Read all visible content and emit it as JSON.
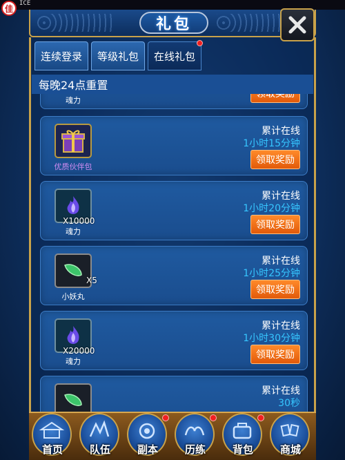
{
  "status": {
    "logo_char": "佳",
    "text": "ICE"
  },
  "header": {
    "title": "礼包"
  },
  "tabs": [
    {
      "label": "连续登录",
      "active": false,
      "has_badge": false
    },
    {
      "label": "等级礼包",
      "active": false,
      "has_badge": false
    },
    {
      "label": "在线礼包",
      "active": true,
      "has_badge": true
    }
  ],
  "notice": "每晚24点重置",
  "rows": [
    {
      "item_name": "魂力",
      "item_icon": "soul-flame-icon",
      "qty": "",
      "label": "累计在线",
      "time": "",
      "button": "领取奖励"
    },
    {
      "item_name": "优质伙伴包",
      "item_icon": "gift-box-icon",
      "qty": "",
      "label": "累计在线",
      "time": "1小时15分钟",
      "button": "领取奖励"
    },
    {
      "item_name": "魂力",
      "item_icon": "soul-flame-icon",
      "qty": "X10000",
      "label": "累计在线",
      "time": "1小时20分钟",
      "button": "领取奖励"
    },
    {
      "item_name": "小妖丸",
      "item_icon": "green-pill-icon",
      "qty": "X5",
      "label": "累计在线",
      "time": "1小时25分钟",
      "button": "领取奖励"
    },
    {
      "item_name": "魂力",
      "item_icon": "soul-flame-icon",
      "qty": "X20000",
      "label": "累计在线",
      "time": "1小时30分钟",
      "button": "领取奖励"
    },
    {
      "item_name": "",
      "item_icon": "green-pill-icon",
      "qty": "",
      "label": "累计在线",
      "time": "30秒",
      "button": ""
    }
  ],
  "bottom_nav": [
    {
      "label": "首页",
      "icon": "home-pagoda-icon",
      "badge": false
    },
    {
      "label": "队伍",
      "icon": "team-icon",
      "badge": false
    },
    {
      "label": "副本",
      "icon": "dungeon-icon",
      "badge": true
    },
    {
      "label": "历练",
      "icon": "training-icon",
      "badge": true
    },
    {
      "label": "背包",
      "icon": "bag-icon",
      "badge": true
    },
    {
      "label": "商城",
      "icon": "shop-icon",
      "badge": false
    }
  ],
  "colors": {
    "accent_gold": "#c9a24a",
    "button_orange": "#e25a0a",
    "time_cyan": "#36c6ff",
    "badge_red": "#f12020"
  }
}
